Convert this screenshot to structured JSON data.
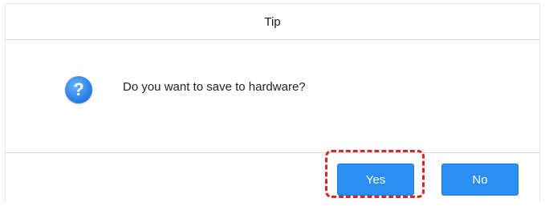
{
  "dialog": {
    "title": "Tip",
    "icon": "question-icon",
    "icon_glyph": "?",
    "message": "Do you want to save to hardware?",
    "buttons": {
      "yes_label": "Yes",
      "no_label": "No"
    },
    "colors": {
      "button_bg": "#2b8ef2",
      "highlight": "#d6262b",
      "icon_bg": "#2f86e8"
    }
  }
}
